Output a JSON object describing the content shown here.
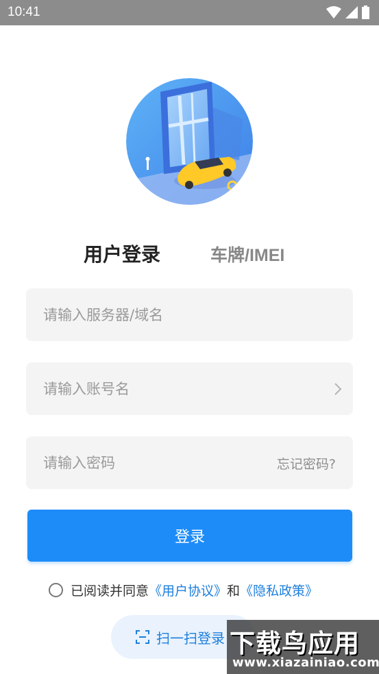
{
  "status_bar": {
    "time": "10:41",
    "icons": [
      "wifi-icon",
      "signal-icon",
      "battery-icon"
    ]
  },
  "tabs": {
    "user_login": "用户登录",
    "plate_imei": "车牌/IMEI"
  },
  "form": {
    "server_placeholder": "请输入服务器/域名",
    "account_placeholder": "请输入账号名",
    "password_placeholder": "请输入密码",
    "forgot_password": "忘记密码?"
  },
  "login_button": "登录",
  "agreement": {
    "prefix": "已阅读并同意",
    "user_agreement": "《用户协议》",
    "conjunction": "和",
    "privacy_policy": "《隐私政策》"
  },
  "scan_login": "扫一扫登录",
  "watermark": {
    "title": "下载鸟应用",
    "url": "www.xiazainiao.com"
  },
  "colors": {
    "accent": "#1d8cf8",
    "link": "#1d7fdc",
    "field_bg": "#f4f4f5",
    "status_bar": "#8c8c8c"
  }
}
